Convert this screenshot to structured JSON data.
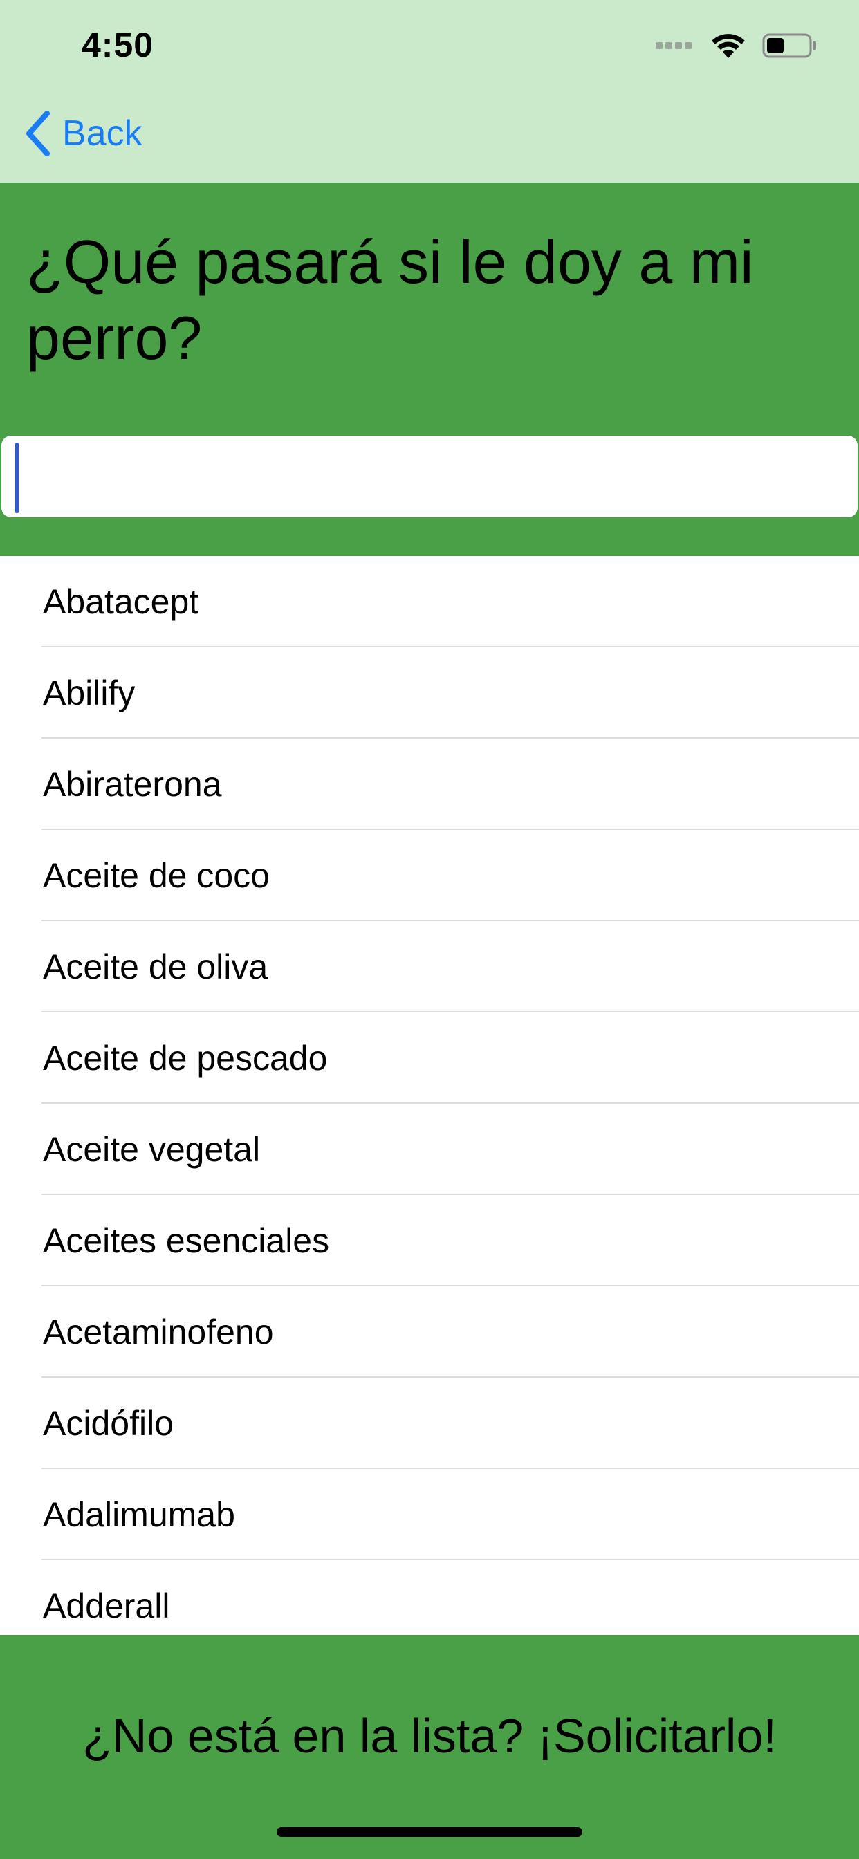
{
  "status_bar": {
    "time": "4:50",
    "icons": [
      "signal-icon",
      "wifi-icon",
      "battery-icon"
    ]
  },
  "nav": {
    "back_label": "Back"
  },
  "header": {
    "title": "¿Qué pasará si le doy a mi perro?",
    "search": {
      "value": "",
      "placeholder": ""
    }
  },
  "list": {
    "items": [
      "Abatacept",
      "Abilify",
      "Abiraterona",
      "Aceite de coco",
      "Aceite de oliva",
      "Aceite de pescado",
      "Aceite vegetal",
      "Aceites esenciales",
      "Acetaminofeno",
      "Acidófilo",
      "Adalimumab",
      "Adderall"
    ]
  },
  "footer": {
    "request_label": "¿No está en la lista? ¡Solicitarlo!"
  },
  "colors": {
    "nav_bg": "#cbeacb",
    "header_bg": "#4aa047",
    "accent": "#1a7cf3",
    "cursor": "#2f5bd3"
  }
}
